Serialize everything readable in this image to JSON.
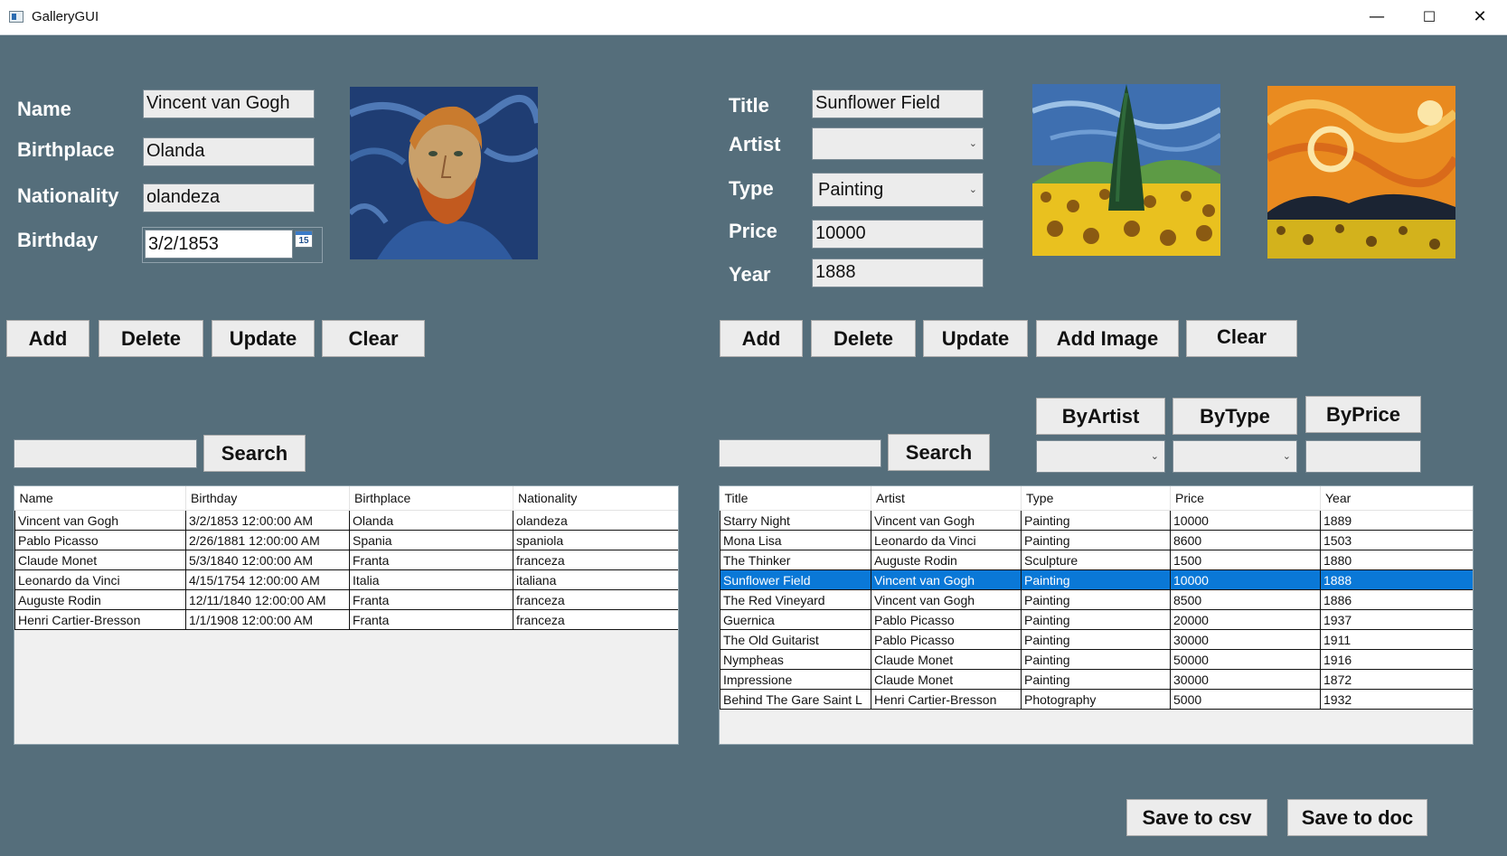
{
  "window": {
    "title": "GalleryGUI",
    "minimize": "—",
    "maximize": "☐",
    "close": "✕"
  },
  "artist_form": {
    "name_label": "Name",
    "birthplace_label": "Birthplace",
    "nationality_label": "Nationality",
    "birthday_label": "Birthday",
    "name": "Vincent van Gogh",
    "birthplace": "Olanda",
    "nationality": "olandeza",
    "birthday": "3/2/1853",
    "calendar_icon": "15"
  },
  "artist_buttons": {
    "add": "Add",
    "delete": "Delete",
    "update": "Update",
    "clear": "Clear"
  },
  "artist_search": {
    "query": "",
    "button": "Search"
  },
  "artist_table": {
    "columns": [
      "Name",
      "Birthday",
      "Birthplace",
      "Nationality"
    ],
    "rows": [
      [
        "Vincent van Gogh",
        "3/2/1853 12:00:00 AM",
        "Olanda",
        "olandeza"
      ],
      [
        "Pablo Picasso",
        "2/26/1881 12:00:00 AM",
        "Spania",
        "spaniola"
      ],
      [
        "Claude Monet",
        "5/3/1840 12:00:00 AM",
        "Franta",
        "franceza"
      ],
      [
        "Leonardo da Vinci",
        "4/15/1754 12:00:00 AM",
        "Italia",
        "italiana"
      ],
      [
        "Auguste Rodin",
        "12/11/1840 12:00:00 AM",
        "Franta",
        "franceza"
      ],
      [
        "Henri Cartier-Bresson",
        "1/1/1908 12:00:00 AM",
        "Franta",
        "franceza"
      ]
    ]
  },
  "artwork_form": {
    "title_label": "Title",
    "artist_label": "Artist",
    "type_label": "Type",
    "price_label": "Price",
    "year_label": "Year",
    "title": "Sunflower Field",
    "artist": "",
    "type": "Painting",
    "price": "10000",
    "year": "1888"
  },
  "artwork_buttons": {
    "add": "Add",
    "delete": "Delete",
    "update": "Update",
    "add_image": "Add Image",
    "clear": "Clear"
  },
  "filters": {
    "by_artist": "ByArtist",
    "by_type": "ByType",
    "by_price": "ByPrice",
    "artist_value": "",
    "type_value": "",
    "price_value": ""
  },
  "artwork_search": {
    "query": "",
    "button": "Search"
  },
  "artwork_table": {
    "columns": [
      "Title",
      "Artist",
      "Type",
      "Price",
      "Year"
    ],
    "selected_index": 3,
    "rows": [
      [
        "Starry Night",
        "Vincent van Gogh",
        "Painting",
        "10000",
        "1889"
      ],
      [
        "Mona Lisa",
        "Leonardo da Vinci",
        "Painting",
        "8600",
        "1503"
      ],
      [
        "The Thinker",
        "Auguste Rodin",
        "Sculpture",
        "1500",
        "1880"
      ],
      [
        "Sunflower Field",
        "Vincent van Gogh",
        "Painting",
        "10000",
        "1888"
      ],
      [
        "The Red Vineyard",
        "Vincent van Gogh",
        "Painting",
        "8500",
        "1886"
      ],
      [
        "Guernica",
        "Pablo Picasso",
        "Painting",
        "20000",
        "1937"
      ],
      [
        "The Old Guitarist",
        "Pablo Picasso",
        "Painting",
        "30000",
        "1911"
      ],
      [
        "Nympheas",
        "Claude Monet",
        "Painting",
        "50000",
        "1916"
      ],
      [
        "Impressione",
        "Claude Monet",
        "Painting",
        "30000",
        "1872"
      ],
      [
        "Behind The Gare Saint L",
        "Henri Cartier-Bresson",
        "Photography",
        "5000",
        "1932"
      ]
    ]
  },
  "export_buttons": {
    "csv": "Save to csv",
    "doc": "Save to doc"
  },
  "colors": {
    "background": "#556e7b",
    "selection": "#0a78d7"
  }
}
